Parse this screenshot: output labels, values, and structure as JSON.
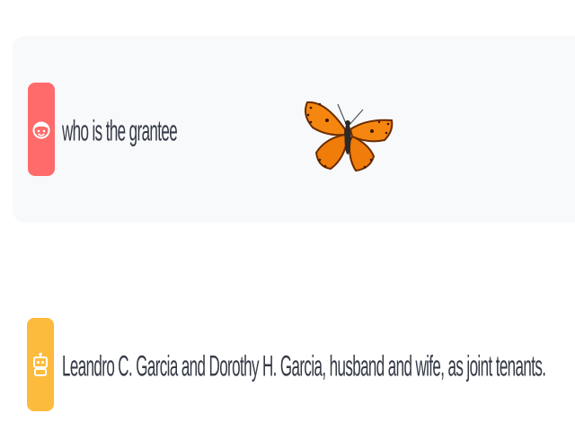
{
  "conversation": {
    "user_message": {
      "text": "who is the grantee",
      "avatar_icon": "user-face-icon",
      "avatar_color": "#ff6b6b"
    },
    "bot_message": {
      "text": "Leandro C. Garcia and Dorothy H. Garcia, husband and wife, as joint tenants.",
      "avatar_icon": "robot-icon",
      "avatar_color": "#fdbb3d"
    },
    "decoration_icon": "butterfly-icon"
  }
}
